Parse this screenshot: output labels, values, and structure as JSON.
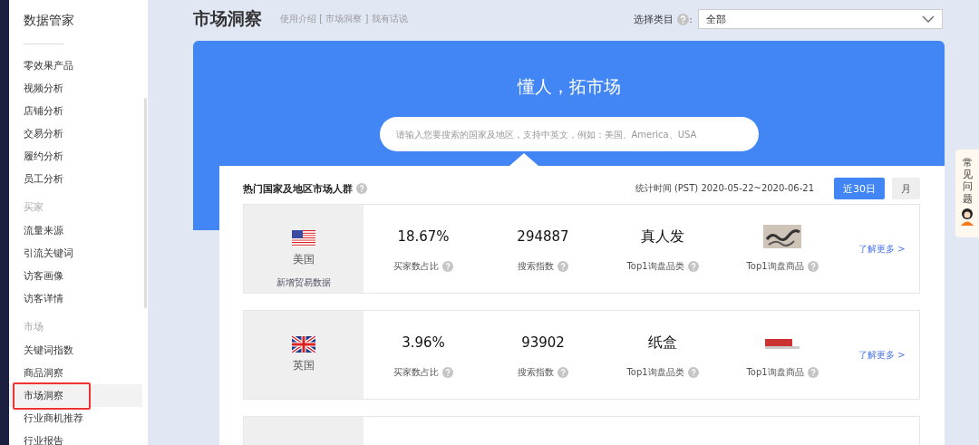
{
  "sidebar": {
    "title": "数据管家",
    "items": [
      {
        "kind": "link",
        "label": "零效果产品",
        "selected": false,
        "highlighted": false
      },
      {
        "kind": "link",
        "label": "视频分析",
        "selected": false,
        "highlighted": false
      },
      {
        "kind": "link",
        "label": "店铺分析",
        "selected": false,
        "highlighted": false
      },
      {
        "kind": "link",
        "label": "交易分析",
        "selected": false,
        "highlighted": false
      },
      {
        "kind": "link",
        "label": "履约分析",
        "selected": false,
        "highlighted": false
      },
      {
        "kind": "link",
        "label": "员工分析",
        "selected": false,
        "highlighted": false
      },
      {
        "kind": "heading",
        "label": "买家"
      },
      {
        "kind": "link",
        "label": "流量来源",
        "selected": false,
        "highlighted": false
      },
      {
        "kind": "link",
        "label": "引流关键词",
        "selected": false,
        "highlighted": false
      },
      {
        "kind": "link",
        "label": "访客画像",
        "selected": false,
        "highlighted": false
      },
      {
        "kind": "link",
        "label": "访客详情",
        "selected": false,
        "highlighted": false
      },
      {
        "kind": "heading",
        "label": "市场"
      },
      {
        "kind": "link",
        "label": "关键词指数",
        "selected": false,
        "highlighted": false
      },
      {
        "kind": "link",
        "label": "商品洞察",
        "selected": false,
        "highlighted": false
      },
      {
        "kind": "link",
        "label": "市场洞察",
        "selected": true,
        "highlighted": true
      },
      {
        "kind": "link",
        "label": "行业商机推荐",
        "selected": false,
        "highlighted": false
      },
      {
        "kind": "link",
        "label": "行业报告",
        "selected": false,
        "highlighted": false
      }
    ]
  },
  "header": {
    "title": "市场洞察",
    "links": "使用介绍 [ 市场洞察 ] 我有话说",
    "category_label": "选择类目",
    "category_colon": ":",
    "category_value": "全部"
  },
  "banner": {
    "slogan": "懂人，拓市场",
    "search": {
      "placeholder": "请输入您要搜索的国家及地区，支持中英文，例如：美国、America、USA"
    }
  },
  "market_card": {
    "title": "热门国家及地区市场人群",
    "period": "统计时间 (PST) 2020-05-22~2020-06-21",
    "ranges": [
      {
        "label": "近30日",
        "selected": true
      },
      {
        "label": "月",
        "selected": false
      }
    ],
    "rows": [
      {
        "kind": "usa",
        "country": "美国",
        "extra_link": "新增贸易数据",
        "more": "了解更多 >",
        "metrics": [
          {
            "kind": "number",
            "value": "18.67%",
            "label": "买家数占比"
          },
          {
            "kind": "number",
            "value": "294887",
            "label": "搜索指数"
          },
          {
            "kind": "category",
            "value": "真人发",
            "label": "Top1询盘品类"
          },
          {
            "kind": "image",
            "label": "Top1询盘商品"
          }
        ]
      },
      {
        "kind": "uk",
        "country": "英国",
        "more": "了解更多 >",
        "metrics": [
          {
            "kind": "number",
            "value": "3.96%",
            "label": "买家数占比"
          },
          {
            "kind": "number",
            "value": "93902",
            "label": "搜索指数"
          },
          {
            "kind": "category",
            "value": "纸盒",
            "label": "Top1询盘品类"
          },
          {
            "kind": "image",
            "label": "Top1询盘商品"
          }
        ]
      }
    ]
  },
  "help_tab": {
    "label": "常见问题"
  }
}
